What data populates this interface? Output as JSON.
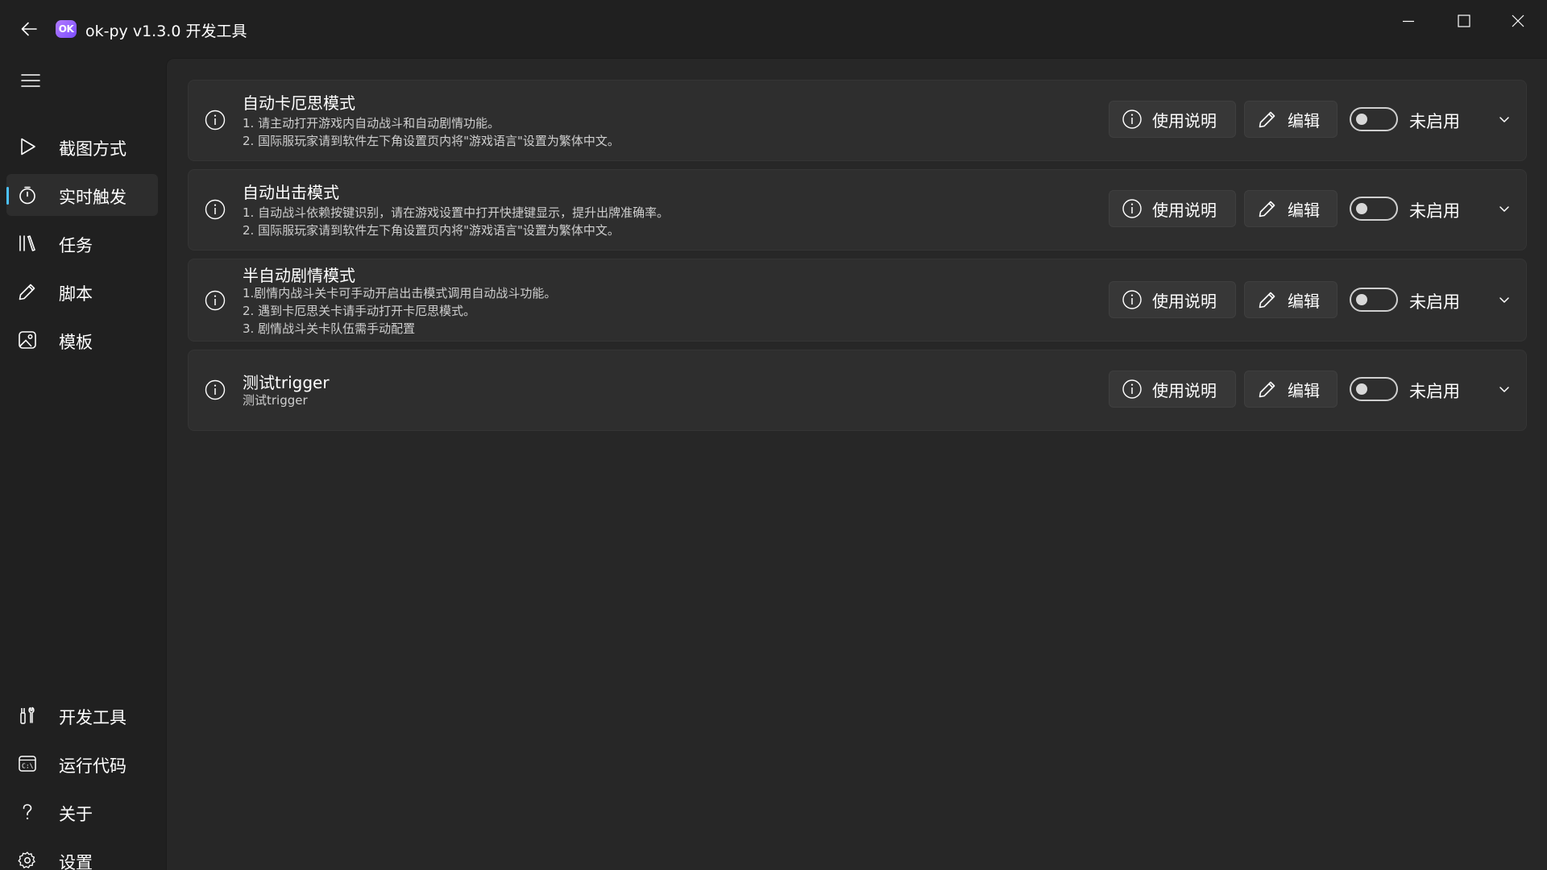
{
  "window": {
    "logo_text": "OK",
    "title": "ok-py v1.3.0  开发工具"
  },
  "sidebar": {
    "top_items": [
      {
        "label": "截图方式",
        "icon": "play-icon"
      },
      {
        "label": "实时触发",
        "icon": "timer-icon",
        "active": true
      },
      {
        "label": "任务",
        "icon": "library-icon"
      },
      {
        "label": "脚本",
        "icon": "pencil-icon"
      },
      {
        "label": "模板",
        "icon": "image-icon"
      }
    ],
    "bottom_items": [
      {
        "label": "开发工具",
        "icon": "tools-icon"
      },
      {
        "label": "运行代码",
        "icon": "terminal-icon"
      },
      {
        "label": "关于",
        "icon": "question-icon"
      },
      {
        "label": "设置",
        "icon": "gear-icon"
      }
    ]
  },
  "buttons": {
    "instructions": "使用说明",
    "edit": "编辑",
    "toggle_off": "未启用"
  },
  "cards": [
    {
      "title": "自动卡厄思模式",
      "desc": [
        "1. 请主动打开游戏内自动战斗和自动剧情功能。",
        "2. 国际服玩家请到软件左下角设置页内将\"游戏语言\"设置为繁体中文。"
      ],
      "enabled": false
    },
    {
      "title": "自动出击模式",
      "desc": [
        "1. 自动战斗依赖按键识别，请在游戏设置中打开快捷键显示，提升出牌准确率。",
        "2. 国际服玩家请到软件左下角设置页内将\"游戏语言\"设置为繁体中文。"
      ],
      "enabled": false
    },
    {
      "title": "半自动剧情模式",
      "desc": [
        "1.剧情内战斗关卡可手动开启出击模式调用自动战斗功能。",
        "2. 遇到卡厄思关卡请手动打开卡厄思模式。",
        "3. 剧情战斗关卡队伍需手动配置"
      ],
      "enabled": false
    },
    {
      "title": "测试trigger",
      "desc": [
        "测试trigger"
      ],
      "enabled": false
    }
  ],
  "colors": {
    "accent": "#4cc2ff",
    "background": "#202020",
    "content": "#272727",
    "card": "#2e2e2e"
  }
}
